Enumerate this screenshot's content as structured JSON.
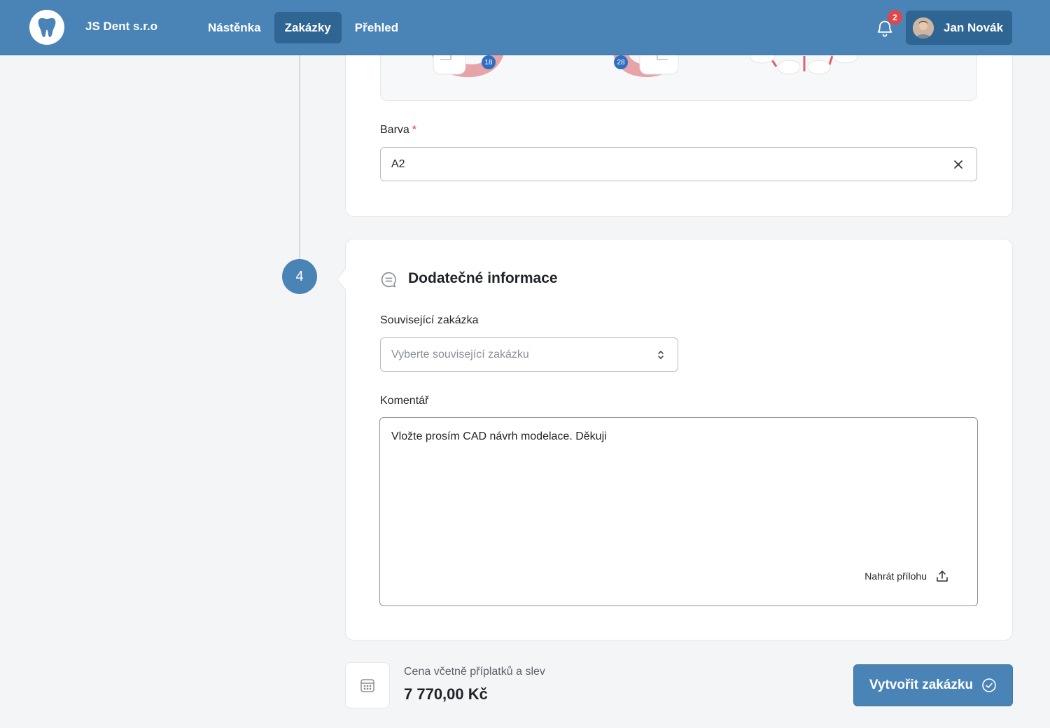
{
  "topbar": {
    "company": "JS Dent s.r.o",
    "nav": [
      {
        "label": "Nástěnka",
        "active": false
      },
      {
        "label": "Zakázky",
        "active": true
      },
      {
        "label": "Přehled",
        "active": false
      }
    ],
    "notification_count": "2",
    "user_name": "Jan Novák"
  },
  "colors": {
    "brand": "#4a84b6",
    "brand_dark": "#2f6592",
    "badge": "#e0474c",
    "required": "#d9363e"
  },
  "tooth_chart": {
    "visible_numbers": [
      "18",
      "28"
    ]
  },
  "barva": {
    "label": "Barva",
    "required_mark": "*",
    "value": "A2"
  },
  "step": {
    "number": "4",
    "title": "Dodatečné informace",
    "icon": "chat-bubble-icon"
  },
  "related_order": {
    "label": "Související zakázka",
    "placeholder": "Vyberte související zakázku"
  },
  "comment": {
    "label": "Komentář",
    "value": "Vložte prosím CAD návrh modelace. Děkuji",
    "upload_label": "Nahrát přílohu"
  },
  "footer": {
    "price_label": "Cena včetně příplatků a slev",
    "price_value": "7 770,00 Kč",
    "create_label": "Vytvořit zakázku"
  }
}
